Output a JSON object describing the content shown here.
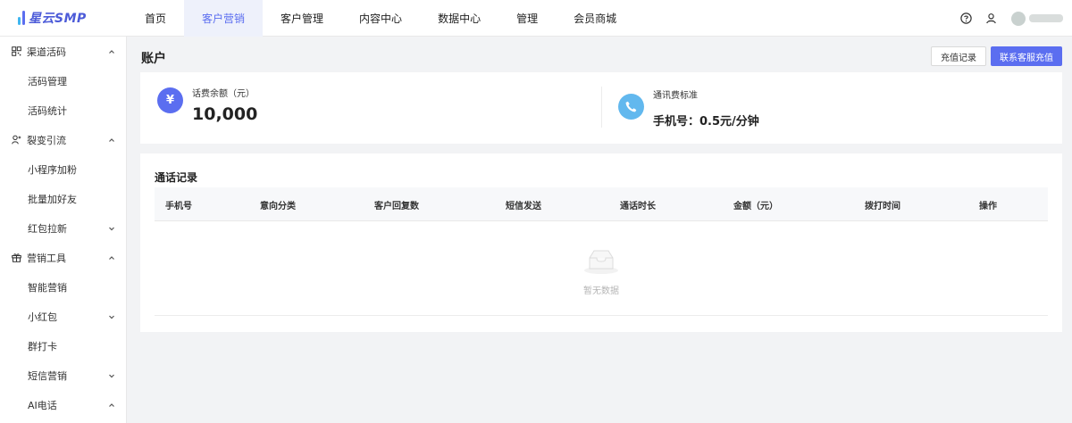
{
  "app": {
    "logo_text": "星云SMP",
    "colors": {
      "brand": "#5b6ef0",
      "logo_text": "#4c5bd8",
      "yuan_icon": "#5b6ef0",
      "phone_icon": "#62b8ee"
    }
  },
  "topnav": {
    "items": [
      {
        "label": "首页",
        "active": false
      },
      {
        "label": "客户营销",
        "active": true
      },
      {
        "label": "客户管理",
        "active": false
      },
      {
        "label": "内容中心",
        "active": false
      },
      {
        "label": "数据中心",
        "active": false
      },
      {
        "label": "管理",
        "active": false
      },
      {
        "label": "会员商城",
        "active": false
      }
    ],
    "icons": [
      "help-icon",
      "user-switch-icon",
      "avatar"
    ]
  },
  "sidebar": {
    "groups": [
      {
        "label": "渠道活码",
        "icon": "qrcode-icon",
        "expanded": true,
        "items": [
          {
            "label": "活码管理",
            "has_children": false
          },
          {
            "label": "活码统计",
            "has_children": false
          }
        ]
      },
      {
        "label": "裂变引流",
        "icon": "fission-icon",
        "expanded": true,
        "items": [
          {
            "label": "小程序加粉",
            "has_children": false
          },
          {
            "label": "批量加好友",
            "has_children": false
          },
          {
            "label": "红包拉新",
            "has_children": true
          }
        ]
      },
      {
        "label": "营销工具",
        "icon": "gift-icon",
        "expanded": true,
        "items": [
          {
            "label": "智能营销",
            "has_children": false
          },
          {
            "label": "小红包",
            "has_children": true
          },
          {
            "label": "群打卡",
            "has_children": false
          },
          {
            "label": "短信营销",
            "has_children": true
          },
          {
            "label": "AI电话",
            "has_children": true
          }
        ]
      }
    ]
  },
  "main": {
    "title": "账户",
    "buttons": {
      "recharge_record": "充值记录",
      "contact_service": "联系客服充值"
    },
    "account": {
      "balance_label": "话费余额（元）",
      "balance_value": "10,000",
      "balance_icon_glyph": "¥",
      "rate_label": "通讯费标准",
      "rate_value": "手机号：0.5元/分钟"
    },
    "call_records": {
      "title": "通话记录",
      "columns": [
        "手机号",
        "意向分类",
        "客户回复数",
        "短信发送",
        "通话时长",
        "金额（元）",
        "拨打时间",
        "操作"
      ],
      "rows": [],
      "empty_text": "暂无数据"
    }
  }
}
